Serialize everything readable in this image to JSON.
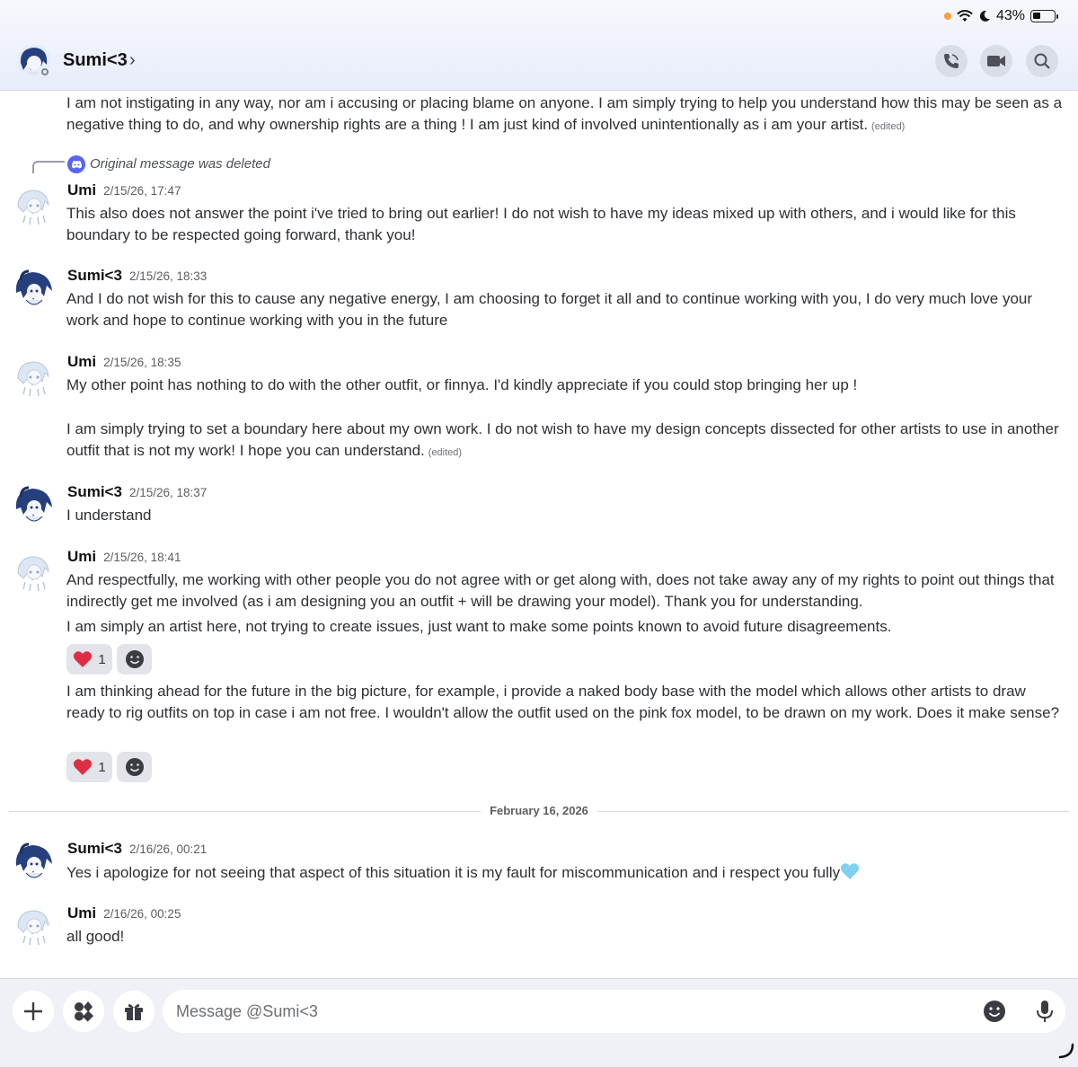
{
  "status_bar": {
    "battery": "43%"
  },
  "header": {
    "name": "Sumi<3",
    "chevron": "›"
  },
  "reply": {
    "text": "Original message was deleted"
  },
  "messages": [
    {
      "text": "I am not instigating in any way, nor am i accusing or placing blame on anyone. I am simply trying to help you understand how this may be seen as a negative thing to do, and why ownership rights are a thing ! I am just kind of involved unintentionally as i am your artist.",
      "edited": "(edited)"
    },
    {
      "author": "Umi",
      "time": "2/15/26, 17:47",
      "text": "This also does not answer the point i've tried to bring out earlier! I do not wish to have my ideas mixed up with others, and i would like for this boundary to be respected going forward, thank you!"
    },
    {
      "author": "Sumi<3",
      "time": "2/15/26, 18:33",
      "text": "And I do not wish for this to cause any negative energy, I am choosing to forget it all and to continue working with you, I do very much love your work and hope to continue working with you in the future"
    },
    {
      "author": "Umi",
      "time": "2/15/26, 18:35",
      "text": "My other point has nothing to do with the other outfit, or finnya. I'd kindly appreciate if you could stop bringing her up !",
      "text2": "I am simply trying to set a boundary here about my own work. I do not wish to have my design concepts dissected for other artists to use in another outfit that is not my work! I hope you can understand.",
      "edited": "(edited)"
    },
    {
      "author": "Sumi<3",
      "time": "2/15/26, 18:37",
      "text": "I understand"
    },
    {
      "author": "Umi",
      "time": "2/15/26, 18:41",
      "text": "And respectfully, me working with other people you do not agree with or get along with, does not take away any of my rights to point out things that indirectly get me involved (as i am designing you an outfit + will be drawing your model). Thank you for understanding.",
      "text2": "I am simply an artist here, not trying to create issues, just want to make some points known to avoid future disagreements.",
      "reaction_count": "1",
      "text3": "I am thinking ahead for the future in the big picture, for example, i provide a naked body base with the model which allows other artists to draw ready to rig outfits on top in case i am not free. I wouldn't allow the outfit used on the pink fox model, to be drawn on my work. Does it make sense?",
      "reaction_count2": "1"
    },
    {
      "author": "Sumi<3",
      "time": "2/16/26, 00:21",
      "text": "Yes i apologize for not seeing that aspect of this situation it is my fault for miscommunication and i respect you fully"
    },
    {
      "author": "Umi",
      "time": "2/16/26, 00:25",
      "text": "all good!"
    }
  ],
  "date_divider": "February 16, 2026",
  "composer": {
    "placeholder": "Message @Sumi<3"
  }
}
